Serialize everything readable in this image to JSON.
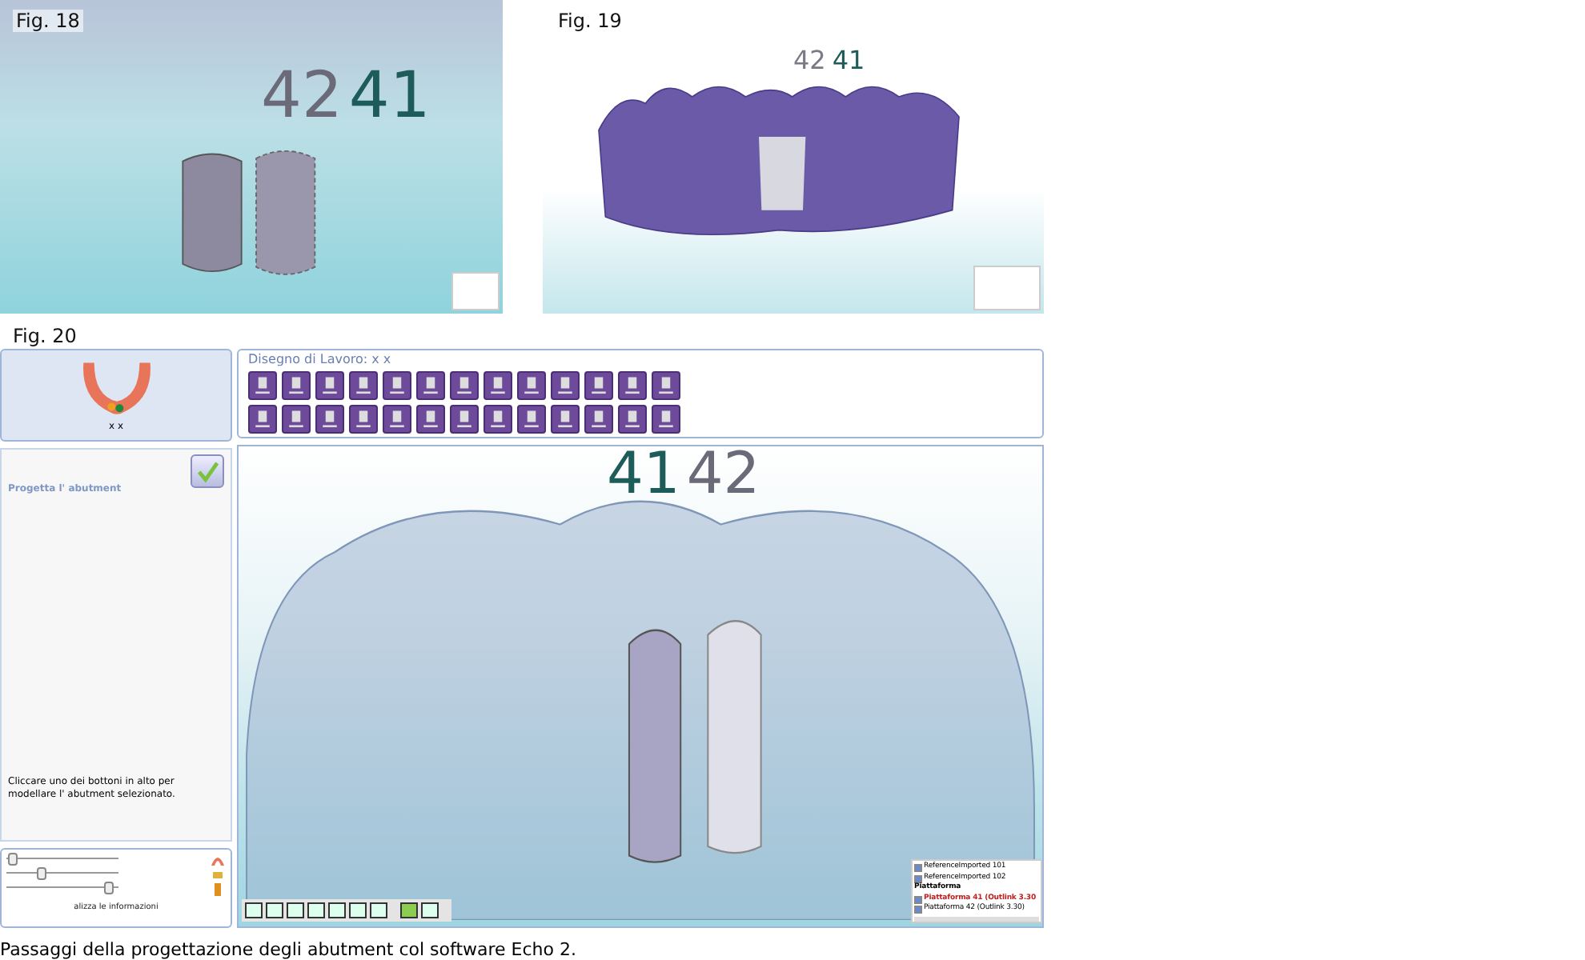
{
  "figures": [
    {
      "label": "Fig. 18",
      "tooth_numbers": [
        {
          "text": "42",
          "color": "#6b6a78"
        },
        {
          "text": "41",
          "color": "#1d5c58"
        }
      ]
    },
    {
      "label": "Fig. 19",
      "tooth_numbers": [
        {
          "text": "42",
          "color": "#7a7a86"
        },
        {
          "text": "41",
          "color": "#1d5c58"
        }
      ]
    }
  ],
  "fig20": {
    "label": "Fig. 20",
    "arch_caption": "x x",
    "work_title": "Disegno di Lavoro: x x",
    "panel_title": "Progetta l' abutment",
    "instructions": "Cliccare uno dei bottoni in alto per modellare l' abutment selezionato.",
    "sliders": [
      {
        "level": 0.02
      },
      {
        "level": 0.3
      },
      {
        "level": 0.95
      }
    ],
    "info_link": "alizza le informazioni",
    "tooth_numbers": [
      {
        "text": "41",
        "color": "#1d5c58"
      },
      {
        "text": "42",
        "color": "#6b6a78"
      }
    ],
    "layers": [
      {
        "kind": "item",
        "label": "ReferenceImported 101",
        "checked": true,
        "selected": false
      },
      {
        "kind": "item",
        "label": "ReferenceImported 102",
        "checked": true,
        "selected": false
      },
      {
        "kind": "header",
        "label": "Piattaforma"
      },
      {
        "kind": "item",
        "label": "Piattaforma 41 (Outlink 3.30",
        "checked": true,
        "selected": true
      },
      {
        "kind": "item",
        "label": "Piattaforma 42 (Outlink 3.30)",
        "checked": true,
        "selected": false
      }
    ]
  },
  "caption": "Passaggi della progettazione degli abutment col software Echo 2."
}
